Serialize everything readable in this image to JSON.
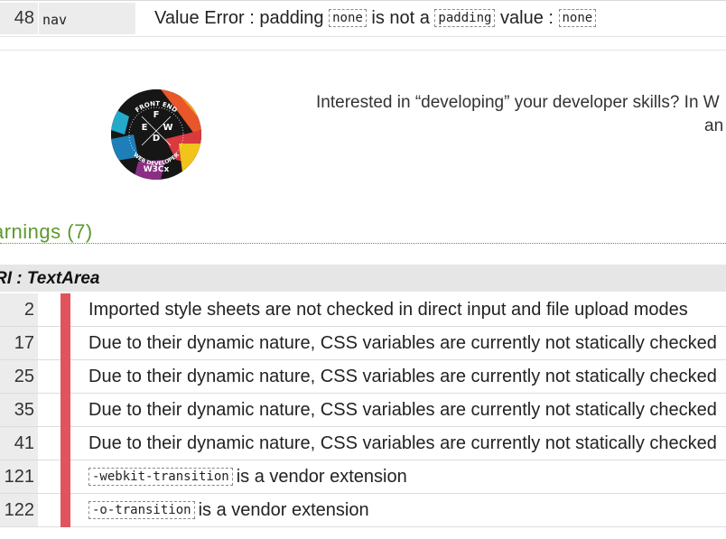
{
  "error_row": {
    "line": "48",
    "context": "nav",
    "prefix": "Value Error : padding",
    "code1": "none",
    "middle": "is not a",
    "code2": "padding",
    "suffix": "value :",
    "code3": "none"
  },
  "promo": {
    "text_line1": "Interested in “developing” your developer skills? In W",
    "text_line2": "an",
    "logo_texts": [
      "FRONT END",
      "WEB DEVELOPER",
      "F",
      "E",
      "W",
      "D",
      "W3Cx"
    ]
  },
  "warnings": {
    "heading": "arnings (7)",
    "uri_label": "RI : TextArea",
    "rows": [
      {
        "line": "2",
        "message": "Imported style sheets are not checked in direct input and file upload modes"
      },
      {
        "line": "17",
        "message": "Due to their dynamic nature, CSS variables are currently not statically checked"
      },
      {
        "line": "25",
        "message": "Due to their dynamic nature, CSS variables are currently not statically checked"
      },
      {
        "line": "35",
        "message": "Due to their dynamic nature, CSS variables are currently not statically checked"
      },
      {
        "line": "41",
        "message": "Due to their dynamic nature, CSS variables are currently not statically checked"
      },
      {
        "line": "121",
        "code": "-webkit-transition",
        "message": "is a vendor extension"
      },
      {
        "line": "122",
        "code": "-o-transition",
        "message": "is a vendor extension"
      }
    ]
  },
  "colors": {
    "warning_heading": "#5c9a2b",
    "warning_bar": "#e0545d",
    "line_cell_bg": "#ececec"
  }
}
